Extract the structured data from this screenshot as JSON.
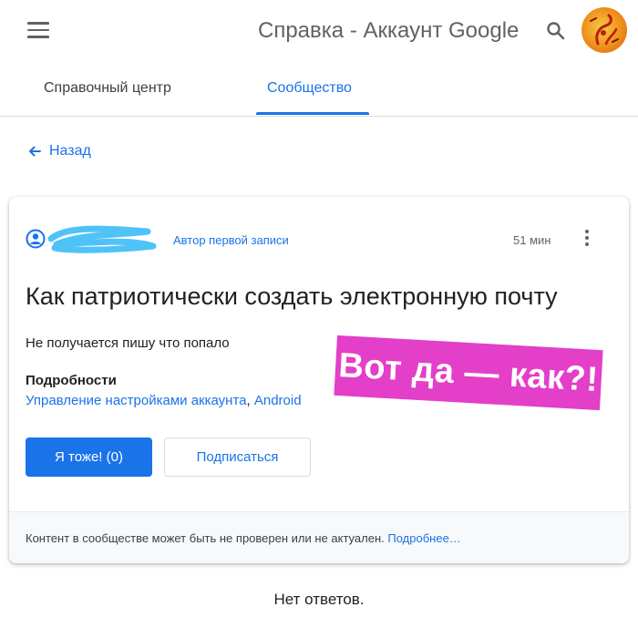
{
  "header": {
    "title": "Справка - Аккаунт Google",
    "icons": {
      "menu": "menu-icon",
      "search": "search-icon",
      "avatar": "avatar"
    }
  },
  "tabs": [
    {
      "label": "Справочный центр",
      "active": false
    },
    {
      "label": "Сообщество",
      "active": true
    }
  ],
  "nav": {
    "back_label": "Назад"
  },
  "post": {
    "author_badge": "Автор первой записи",
    "time": "51 мин",
    "title": "Как патриотически создать электронную почту",
    "body": "Не получается пишу что попало",
    "details_label": "Подробности",
    "details_links": [
      "Управление настройками аккаунта",
      "Android"
    ],
    "details_separator": ", ",
    "buttons": {
      "me_too": "Я тоже! (0)",
      "subscribe": "Подписаться"
    },
    "footer_text": "Контент в сообществе может быть не проверен или не актуален.",
    "footer_link": "Подробнее…"
  },
  "sticker": {
    "text": "Вот да — как?!"
  },
  "replies": {
    "empty_text": "Нет ответов."
  },
  "colors": {
    "accent": "#1a73e8",
    "sticker": "#e33fc9",
    "redaction": "#4fc3f7"
  }
}
